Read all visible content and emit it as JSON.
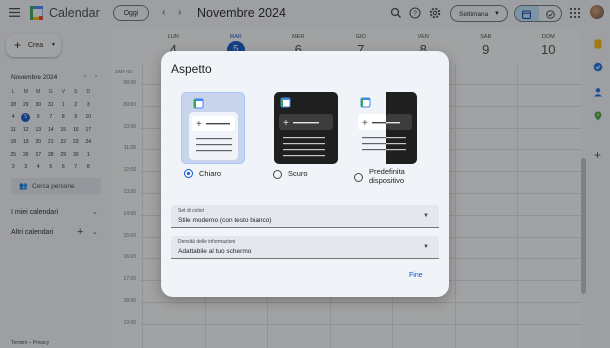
{
  "app": {
    "title": "Calendar"
  },
  "header": {
    "today_label": "Oggi",
    "prev_label": "‹",
    "next_label": "›",
    "date_range": "Novembre 2024",
    "view_label": "Settimana",
    "icons": [
      "search-icon",
      "help-icon",
      "settings-icon",
      "calendar-view-icon",
      "tasks-view-icon",
      "apps-icon",
      "avatar"
    ]
  },
  "sidebar": {
    "create_label": "Crea",
    "mini_calendar": {
      "month": "Novembre 2024",
      "weekdays": [
        "L",
        "M",
        "M",
        "G",
        "V",
        "S",
        "D"
      ],
      "weeks": [
        [
          "28",
          "29",
          "30",
          "31",
          "1",
          "2",
          "3"
        ],
        [
          "4",
          "5",
          "6",
          "7",
          "8",
          "9",
          "10"
        ],
        [
          "11",
          "12",
          "13",
          "14",
          "15",
          "16",
          "17"
        ],
        [
          "18",
          "19",
          "20",
          "21",
          "22",
          "23",
          "24"
        ],
        [
          "25",
          "26",
          "27",
          "28",
          "29",
          "30",
          "1"
        ],
        [
          "2",
          "3",
          "4",
          "5",
          "6",
          "7",
          "8"
        ]
      ],
      "today": "5"
    },
    "search_people": "Cerca persone",
    "my_calendars": "I miei calendari",
    "other_calendars": "Altri calendari",
    "footer": "Termini – Privacy"
  },
  "week": {
    "timezone": "GMT+01",
    "days": [
      {
        "name": "LUN",
        "num": "4"
      },
      {
        "name": "MAR",
        "num": "5",
        "today": true
      },
      {
        "name": "MER",
        "num": "6"
      },
      {
        "name": "GIO",
        "num": "7"
      },
      {
        "name": "VEN",
        "num": "8"
      },
      {
        "name": "SAB",
        "num": "9"
      },
      {
        "name": "DOM",
        "num": "10"
      }
    ],
    "times": [
      "08:00",
      "09:00",
      "10:00",
      "11:00",
      "12:00",
      "13:00",
      "14:00",
      "15:00",
      "16:00",
      "17:00",
      "18:00",
      "19:00"
    ]
  },
  "dialog": {
    "title": "Aspetto",
    "options": [
      {
        "label": "Chiaro",
        "selected": true
      },
      {
        "label": "Scuro",
        "selected": false
      },
      {
        "label": "Predefinita dispositivo",
        "selected": false
      }
    ],
    "color_set": {
      "label": "Set di colori",
      "value": "Stile moderno (con testo bianco)"
    },
    "density": {
      "label": "Densità delle informazioni",
      "value": "Adattabile al tuo schermo"
    },
    "done_label": "Fine"
  },
  "colors": {
    "accent": "#0b57d0",
    "accent_light": "#c2e7ff",
    "dialog_bg": "#f0f4f9"
  }
}
